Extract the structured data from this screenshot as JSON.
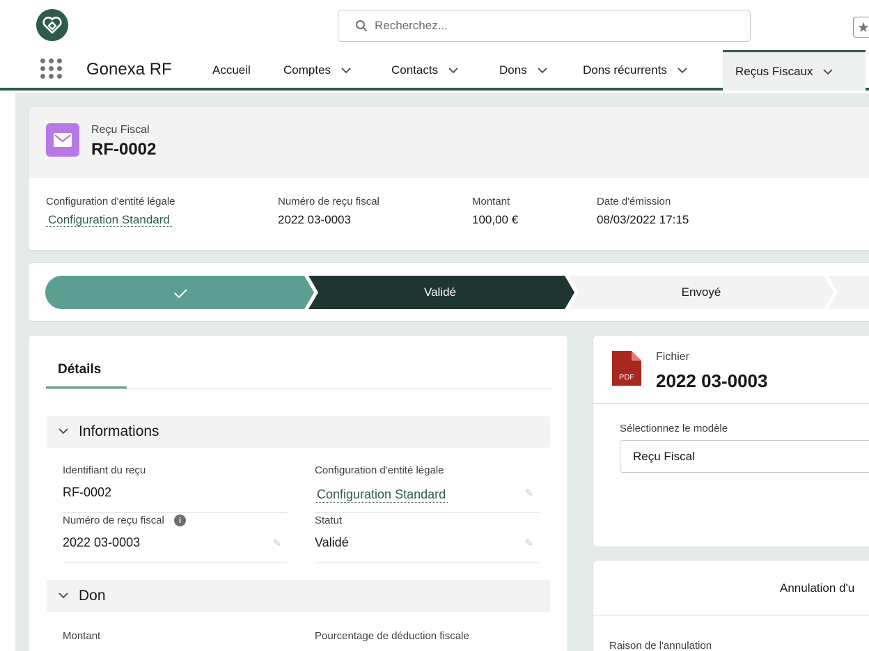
{
  "header": {
    "search_placeholder": "Recherchez..."
  },
  "nav": {
    "app_name": "Gonexa RF",
    "items": [
      {
        "label": "Accueil"
      },
      {
        "label": "Comptes"
      },
      {
        "label": "Contacts"
      },
      {
        "label": "Dons"
      },
      {
        "label": "Dons récurrents"
      },
      {
        "label": "Reçus Fiscaux"
      }
    ],
    "active": "Reçus Fiscaux"
  },
  "record": {
    "type": "Reçu Fiscal",
    "title": "RF-0002",
    "highlights": [
      {
        "label": "Configuration d'entité légale",
        "value": "Configuration Standard"
      },
      {
        "label": "Numéro de reçu fiscal",
        "value": "2022 03-0003"
      },
      {
        "label": "Montant",
        "value": "100,00 €"
      },
      {
        "label": "Date d'émission",
        "value": "08/03/2022 17:15"
      }
    ]
  },
  "path": {
    "steps": [
      {
        "label": "✓",
        "state": "complete"
      },
      {
        "label": "Validé",
        "state": "current"
      },
      {
        "label": "Envoyé",
        "state": "incomplete"
      }
    ]
  },
  "details": {
    "tab_label": "Détails",
    "sections": [
      {
        "title": "Informations"
      },
      {
        "title": "Don"
      }
    ],
    "fields": {
      "receipt_id": {
        "label": "Identifiant du reçu",
        "value": "RF-0002"
      },
      "legal_config": {
        "label": "Configuration d'entité légale",
        "value": "Configuration Standard"
      },
      "tax_number": {
        "label": "Numéro de reçu fiscal",
        "value": "2022 03-0003"
      },
      "status": {
        "label": "Statut",
        "value": "Validé"
      },
      "amount": {
        "label": "Montant"
      },
      "deduction": {
        "label": "Pourcentage de déduction fiscale"
      }
    }
  },
  "file": {
    "type": "Fichier",
    "name": "2022 03-0003",
    "icon_text": "PDF",
    "template_label": "Sélectionnez le modèle",
    "template_value": "Reçu Fiscal"
  },
  "cancellation": {
    "title": "Annulation d'u",
    "reason_label": "Raison de l'annulation"
  },
  "colors": {
    "brand": "#2e5b4e",
    "path_complete": "#5c9e92",
    "path_current": "#1f3532",
    "record_icon": "#b779e6",
    "pdf_icon": "#a82820"
  }
}
